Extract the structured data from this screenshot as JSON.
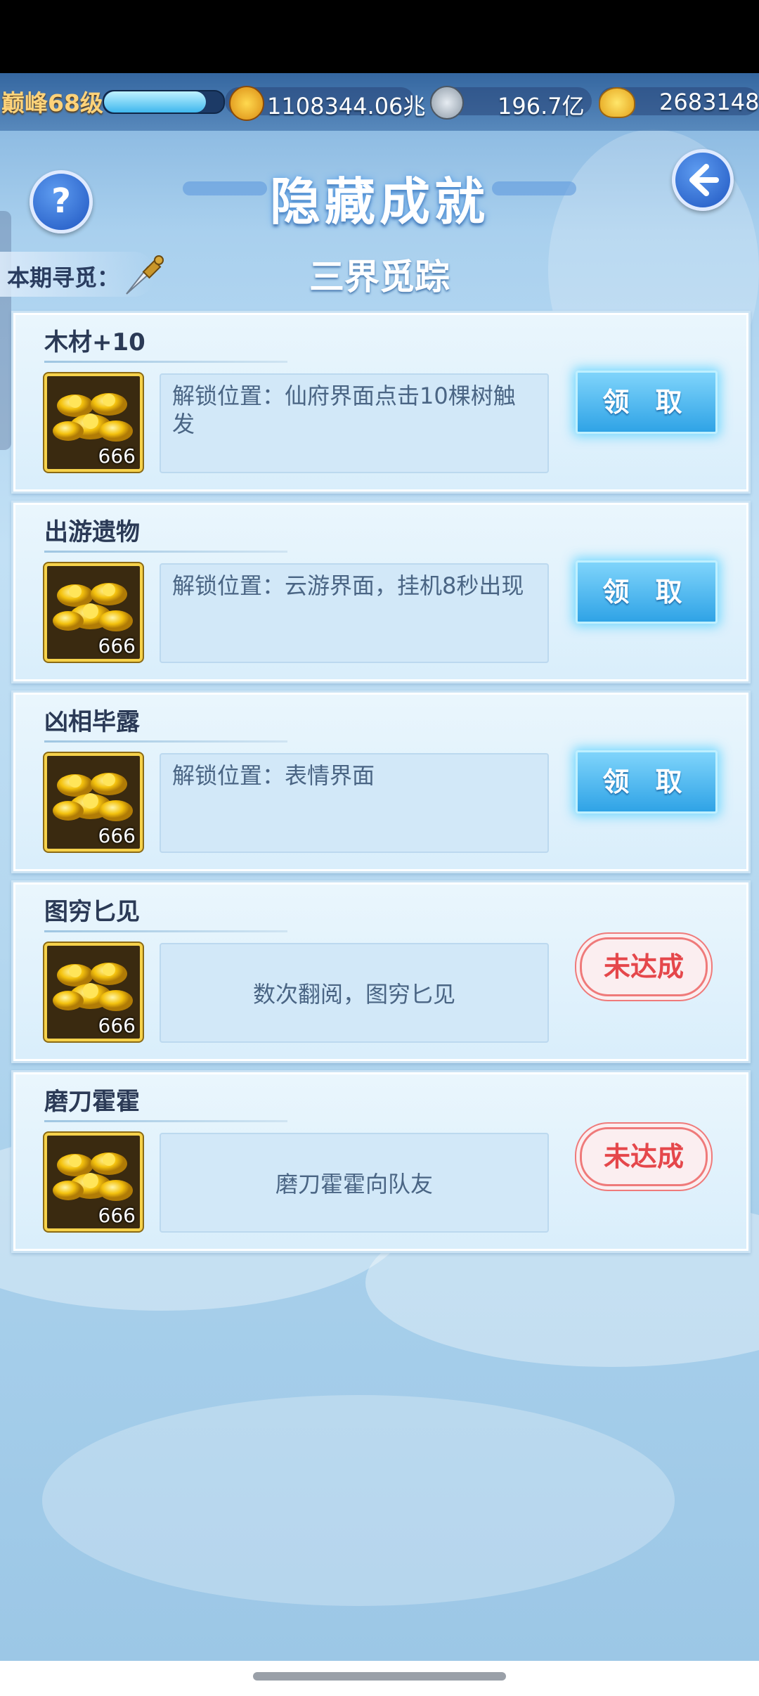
{
  "resources": {
    "level": "巅峰68级",
    "exp_fraction": 0.85,
    "combat_power": "1108344.06兆",
    "silver": "196.7亿",
    "gold": "2683148"
  },
  "header": {
    "title": "隐藏成就",
    "help_label": "?",
    "period_label": "本期寻觅：",
    "subtitle": "三界觅踪"
  },
  "achievements": [
    {
      "name": "木材+10",
      "reward_count": "666",
      "description": "解锁位置：仙府界面点击10棵树触发",
      "action": "领 取",
      "status": "claimable"
    },
    {
      "name": "出游遗物",
      "reward_count": "666",
      "description": "解锁位置：云游界面，挂机8秒出现",
      "action": "领 取",
      "status": "claimable"
    },
    {
      "name": "凶相毕露",
      "reward_count": "666",
      "description": "解锁位置：表情界面",
      "action": "领 取",
      "status": "claimable"
    },
    {
      "name": "图穷匕见",
      "reward_count": "666",
      "description": "数次翻阅，图穷匕见",
      "action": "未达成",
      "status": "incomplete"
    },
    {
      "name": "磨刀霍霍",
      "reward_count": "666",
      "description": "磨刀霍霍向队友",
      "action": "未达成",
      "status": "incomplete"
    }
  ],
  "colors": {
    "accent": "#2fa3e6",
    "pending": "#e5474b",
    "gold": "#f6d24b"
  }
}
